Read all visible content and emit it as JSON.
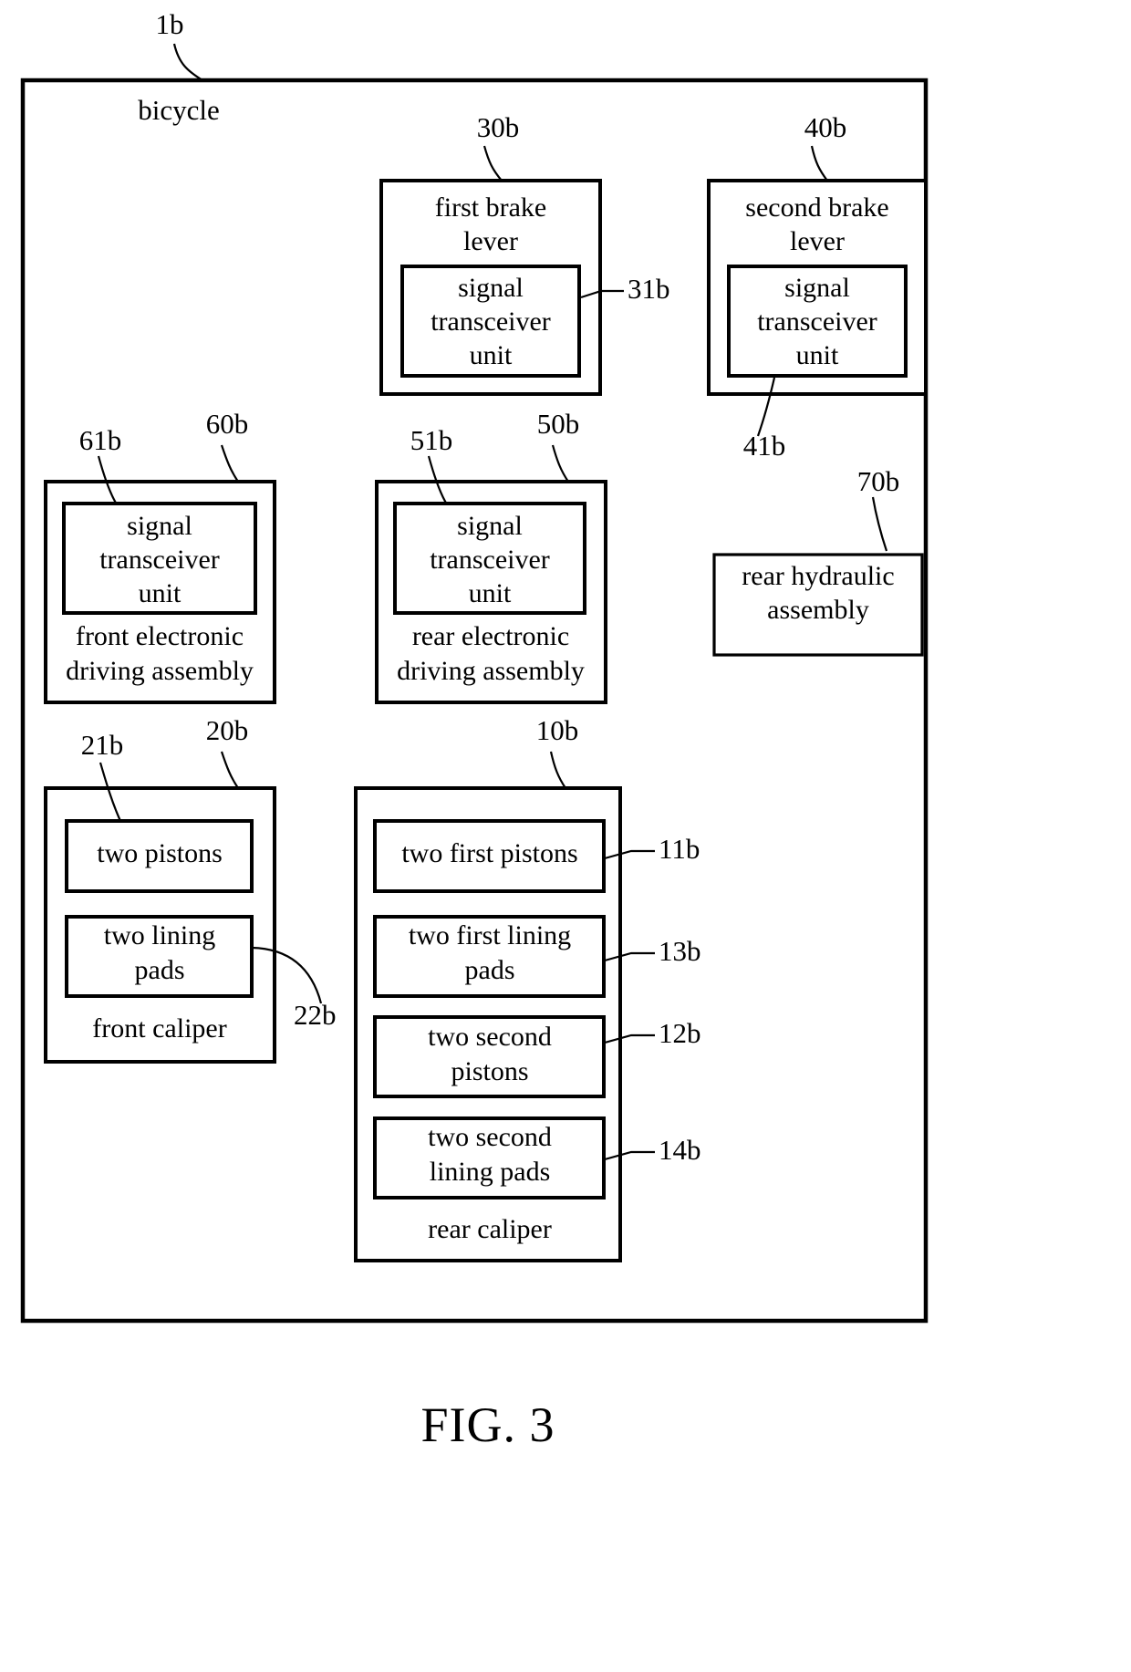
{
  "figure": {
    "caption": "FIG. 3",
    "outer_ref": "1b",
    "outer_label": "bicycle"
  },
  "blocks": {
    "first_brake_lever": {
      "label": "first brake lever",
      "line1": "first brake",
      "line2": "lever",
      "ref": "30b"
    },
    "first_lever_transceiver": {
      "line1": "signal",
      "line2": "transceiver",
      "line3": "unit",
      "ref": "31b"
    },
    "second_brake_lever": {
      "label": "second brake lever",
      "line1": "second brake",
      "line2": "lever",
      "ref": "40b"
    },
    "second_lever_transceiver": {
      "line1": "signal",
      "line2": "transceiver",
      "line3": "unit",
      "ref": "41b"
    },
    "front_driving_assembly": {
      "line1": "front electronic",
      "line2": "driving assembly",
      "ref": "60b"
    },
    "front_driving_transceiver": {
      "line1": "signal",
      "line2": "transceiver",
      "line3": "unit",
      "ref": "61b"
    },
    "rear_driving_assembly": {
      "line1": "rear electronic",
      "line2": "driving assembly",
      "ref": "50b"
    },
    "rear_driving_transceiver": {
      "line1": "signal",
      "line2": "transceiver",
      "line3": "unit",
      "ref": "51b"
    },
    "rear_hydraulic_assembly": {
      "line1": "rear hydraulic",
      "line2": "assembly",
      "ref": "70b"
    },
    "front_caliper": {
      "label": "front caliper",
      "ref": "20b"
    },
    "front_pistons": {
      "line1": "two pistons",
      "ref": "21b"
    },
    "front_lining_pads": {
      "line1": "two lining",
      "line2": "pads",
      "ref": "22b"
    },
    "rear_caliper": {
      "label": "rear caliper",
      "ref": "10b"
    },
    "rear_first_pistons": {
      "line1": "two first pistons",
      "ref": "11b"
    },
    "rear_first_lining_pads": {
      "line1": "two first lining",
      "line2": "pads",
      "ref": "13b"
    },
    "rear_second_pistons": {
      "line1": "two second",
      "line2": "pistons",
      "ref": "12b"
    },
    "rear_second_lining_pads": {
      "line1": "two second",
      "line2": "lining pads",
      "ref": "14b"
    }
  },
  "colors": {
    "line": "#000000",
    "background": "#ffffff"
  }
}
